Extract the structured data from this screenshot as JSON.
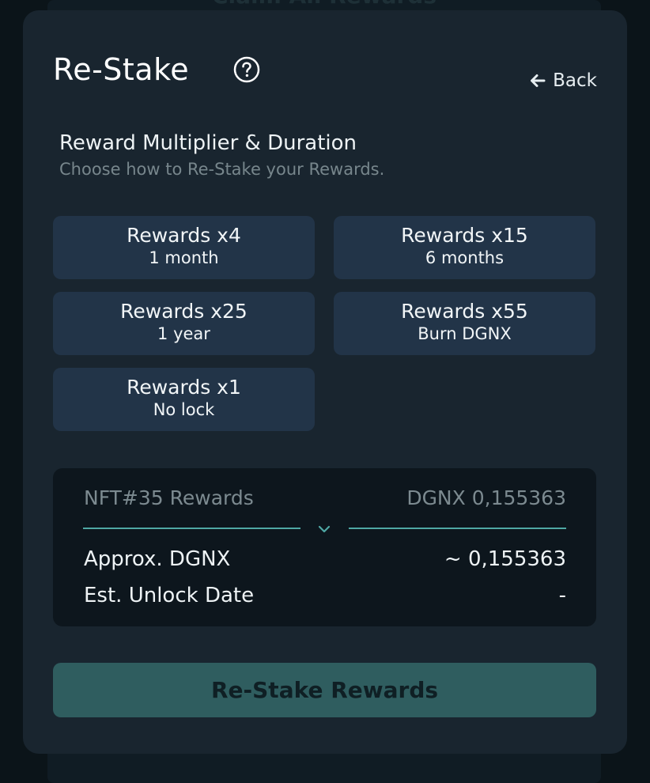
{
  "background": {
    "claim_all_label": "Claim All Rewards"
  },
  "modal": {
    "title": "Re-Stake",
    "help_icon": "question-circle-icon",
    "back_label": "Back",
    "back_icon": "arrow-left-icon"
  },
  "section": {
    "heading": "Reward Multiplier & Duration",
    "subheading": "Choose how to Re-Stake your Rewards."
  },
  "options": [
    {
      "title": "Rewards x4",
      "subtitle": "1 month"
    },
    {
      "title": "Rewards x15",
      "subtitle": "6 months"
    },
    {
      "title": "Rewards x25",
      "subtitle": "1 year"
    },
    {
      "title": "Rewards x55",
      "subtitle": "Burn DGNX"
    },
    {
      "title": "Rewards x1",
      "subtitle": "No lock"
    }
  ],
  "summary": {
    "nft_label": "NFT#35 Rewards",
    "nft_value": "DGNX 0,155363",
    "divider_icon": "chevron-down-icon",
    "approx_label": "Approx. DGNX",
    "approx_value": "~ 0,155363",
    "unlock_label": "Est. Unlock Date",
    "unlock_value": "-"
  },
  "submit": {
    "label": "Re-Stake Rewards"
  },
  "colors": {
    "page_bg": "#0b1419",
    "modal_bg": "#19252f",
    "option_bg": "#223448",
    "summary_bg": "#0d161d",
    "accent": "#4fa8a4",
    "button_bg": "#2f5d5f"
  }
}
